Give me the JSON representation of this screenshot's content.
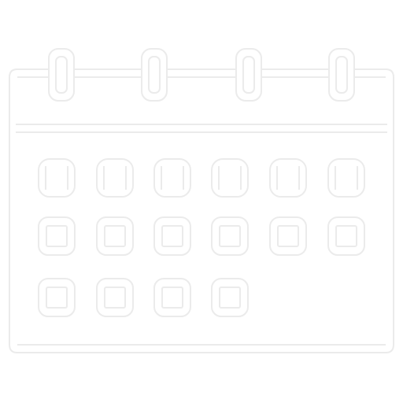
{
  "icon": {
    "name": "calendar-icon",
    "stroke_color": "#ebebeb",
    "fill_color": "#ffffff",
    "rings": 4,
    "cell_rows": [
      {
        "kind": "header-slot",
        "count": 6
      },
      {
        "kind": "day-box",
        "count": 6
      },
      {
        "kind": "day-box",
        "count": 4
      }
    ]
  }
}
